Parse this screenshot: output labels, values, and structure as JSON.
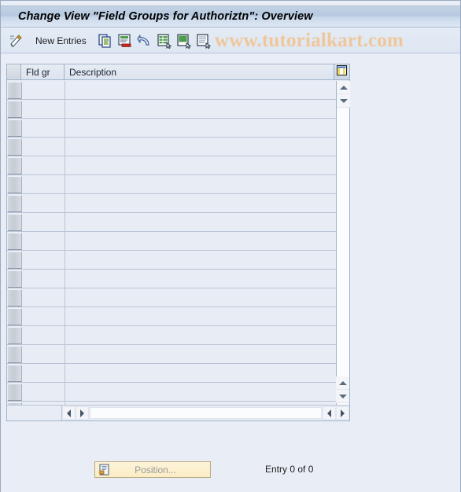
{
  "window": {
    "title": "Change View \"Field Groups for Authoriztn\": Overview"
  },
  "toolbar": {
    "display_change_icon": "pencil-paper-icon",
    "new_entries_label": "New Entries",
    "buttons": [
      {
        "name": "copy-as-icon",
        "label": "Copy As..."
      },
      {
        "name": "delete-icon",
        "label": "Delete"
      },
      {
        "name": "undo-icon",
        "label": "Undo Change"
      },
      {
        "name": "select-all-icon",
        "label": "Select All"
      },
      {
        "name": "select-block-icon",
        "label": "Select Block"
      },
      {
        "name": "deselect-all-icon",
        "label": "Deselect All"
      }
    ]
  },
  "watermark": {
    "text": "www.tutorialkart.com",
    "color": "#f0c79a"
  },
  "table": {
    "columns": [
      {
        "key": "fld_gr",
        "label": "Fld gr"
      },
      {
        "key": "description",
        "label": "Description"
      }
    ],
    "config_icon": "table-settings-icon",
    "rows": [],
    "empty_row_count": 18,
    "vertical_scroll": {
      "up_icon": "scroll-up-icon",
      "down_icon": "scroll-down-icon"
    },
    "horizontal_scroll": {
      "left_icon": "scroll-left-icon",
      "right_icon": "scroll-right-icon"
    }
  },
  "footer": {
    "position_button": {
      "label": "Position...",
      "icon": "position-icon",
      "enabled": false
    },
    "entry_count": "Entry 0 of 0"
  },
  "colors": {
    "window_bg": "#e9eef6",
    "title_bar": "#b6c9e0",
    "row_bg": "#e8edf5",
    "grid_line": "#b9c4d4",
    "border": "#9fb3cc",
    "button_yellow": "#fbedc6"
  }
}
